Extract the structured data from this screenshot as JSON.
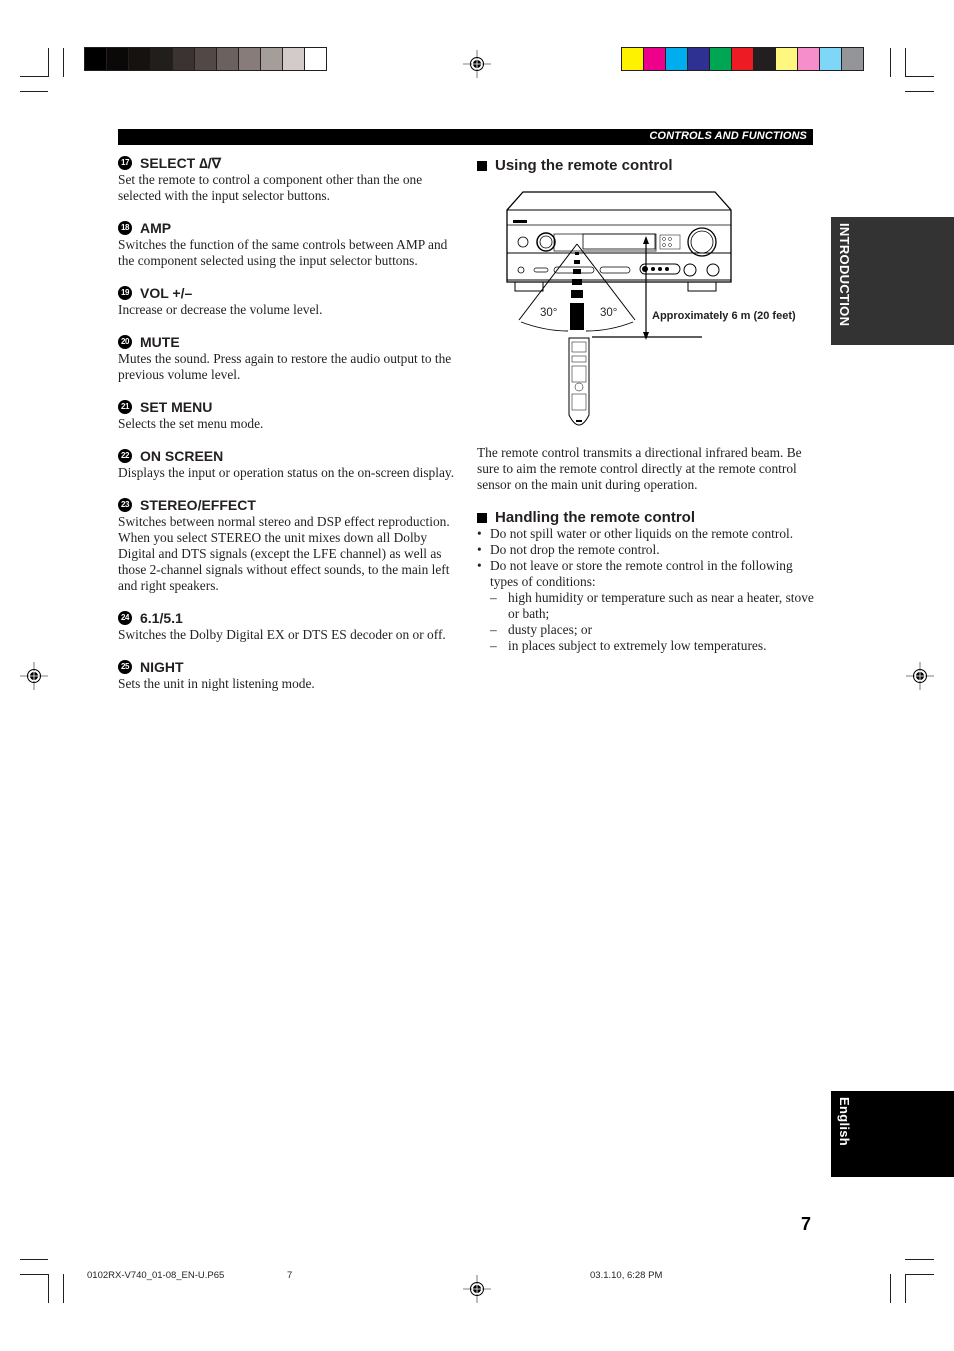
{
  "header": {
    "section_title": "CONTROLS AND FUNCTIONS"
  },
  "color_bars": {
    "grayscale": [
      "#000000",
      "#0b0908",
      "#151210",
      "#221e1c",
      "#3b3331",
      "#524846",
      "#6b615e",
      "#877c79",
      "#a59d9a",
      "#d2cbc9",
      "#ffffff"
    ],
    "process": [
      "#fff200",
      "#ec008c",
      "#00aeef",
      "#2e3192",
      "#00a651",
      "#ed1c24",
      "#231f20",
      "#fff77f",
      "#f68ecb",
      "#7fd6f7",
      "#939598"
    ]
  },
  "left_items": [
    {
      "number": "17",
      "title": "SELECT ∆/∇",
      "body": "Set the remote to control a component other than the one selected with the input selector buttons."
    },
    {
      "number": "18",
      "title": "AMP",
      "body": "Switches the function of the same controls between AMP and the component selected using the input selector buttons."
    },
    {
      "number": "19",
      "title": "VOL +/–",
      "body": "Increase or decrease the volume level."
    },
    {
      "number": "20",
      "title": "MUTE",
      "body": "Mutes the sound. Press again to restore the audio output to the previous volume level."
    },
    {
      "number": "21",
      "title": "SET MENU",
      "body": "Selects the set menu mode."
    },
    {
      "number": "22",
      "title": "ON SCREEN",
      "body": "Displays the input or operation status on the on-screen display."
    },
    {
      "number": "23",
      "title": "STEREO/EFFECT",
      "body": "Switches between normal stereo and DSP effect reproduction. When you select STEREO the unit mixes down all Dolby Digital and DTS signals (except the LFE channel) as well as those 2-channel signals without effect sounds, to the main left and right speakers."
    },
    {
      "number": "24",
      "title": "6.1/5.1",
      "body": "Switches the Dolby Digital EX or DTS ES decoder on or off."
    },
    {
      "number": "25",
      "title": "NIGHT",
      "body": "Sets the unit in night listening mode."
    }
  ],
  "using_remote": {
    "title": "Using the remote control",
    "diagram": {
      "angle_left": "30°",
      "angle_right": "30°",
      "distance_label": "Approximately 6 m (20 feet)"
    },
    "paragraph": "The remote control transmits a directional infrared beam. Be sure to aim the remote control directly at the remote control sensor on the main unit during operation."
  },
  "handling_remote": {
    "title": "Handling the remote control",
    "bullets": [
      "Do not spill water or other liquids on the remote control.",
      "Do not drop the remote control.",
      "Do not leave or store the remote control in the following types of conditions:"
    ],
    "sub_items": [
      "high humidity or temperature such as near a heater, stove or bath;",
      "dusty places; or",
      "in places subject to extremely low temperatures."
    ]
  },
  "side_tabs": {
    "section": "INTRODUCTION",
    "language": "English"
  },
  "page_number": "7",
  "footer": {
    "file_name": "0102RX-V740_01-08_EN-U.P65",
    "page": "7",
    "timestamp": "03.1.10, 6:28 PM"
  }
}
